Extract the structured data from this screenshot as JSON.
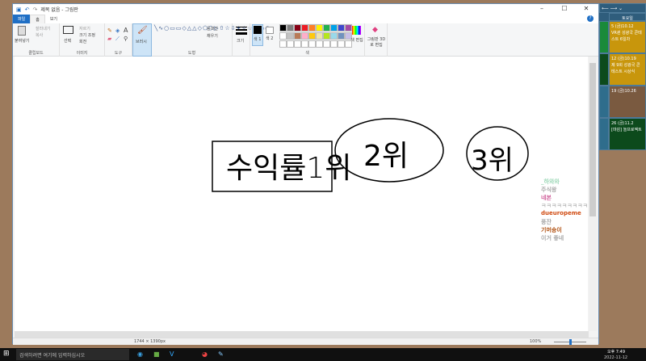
{
  "window": {
    "title": "제목 없음 - 그림판",
    "minimize": "–",
    "maximize": "☐",
    "close": "✕",
    "help": "?"
  },
  "tabs": [
    "파일",
    "홈",
    "보기"
  ],
  "ribbon": {
    "clipboard": {
      "paste": "붙여넣기",
      "cut": "잘라내기",
      "copy": "복사",
      "label": "클립보드"
    },
    "image": {
      "select": "선택",
      "crop": "자르기",
      "resize": "크기 조정",
      "rotate": "회전",
      "label": "이미지"
    },
    "tools": {
      "label": "도구"
    },
    "brushes": {
      "label": "브러시"
    },
    "shapes": {
      "outline": "윤곽선",
      "fill": "채우기",
      "label": "도형"
    },
    "size": {
      "label": "크기"
    },
    "colors": {
      "color1": "색 1",
      "color2": "색 2",
      "edit": "색 편집",
      "label": "색",
      "palette": [
        "#000000",
        "#7f7f7f",
        "#880015",
        "#ed1c24",
        "#ff7f27",
        "#fff200",
        "#22b14c",
        "#00a2e8",
        "#3f48cc",
        "#a349a4",
        "#ffffff",
        "#c3c3c3",
        "#b97a57",
        "#ffaec9",
        "#ffc90e",
        "#efe4b0",
        "#b5e61d",
        "#99d9ea",
        "#7092be",
        "#c8bfe7"
      ]
    },
    "paint3d": "그림판 3D로 편집"
  },
  "drawing": {
    "box_text": "수익률1위",
    "circle2_text": "2위",
    "circle3_text": "3위"
  },
  "overlay_notes": [
    {
      "text": "_하와와",
      "color": "#9ed8b8"
    },
    {
      "text": "주식왕",
      "color": "#aaaaaa"
    },
    {
      "text": "네본",
      "color": "#d0609a"
    },
    {
      "text": "ㅋㅋㅋㅋㅋㅋㅋㅋㅋㅋ",
      "color": "#bbbbbb"
    },
    {
      "text": "dueuropeme",
      "color": "#d04a10"
    },
    {
      "text": "풍잔",
      "color": "#aaaaaa"
    },
    {
      "text": "기머숑이",
      "color": "#b05010"
    },
    {
      "text": "이거 좋네",
      "color": "#aaaaaa"
    }
  ],
  "status": {
    "dimensions": "1744 × 1390px",
    "zoom": "100%",
    "zoom_level": 0.5
  },
  "taskbar": {
    "search_placeholder": "검색하려면 여기에 입력하십시오",
    "time": "오후 7:49",
    "date": "2022-11-12"
  },
  "calendar": {
    "header": "토요일",
    "events": [
      {
        "date": "5 (금)10.12",
        "text": "VR퀸 성광국 콘테스트 6일차",
        "color": "#c8960c"
      },
      {
        "date": "12 (금)10.19",
        "text": "제 9회 성광국 콘테스트 시상식",
        "color": "#c8960c"
      },
      {
        "date": "19 (금)10.26",
        "text": "",
        "color": "#7a5a40"
      },
      {
        "date": "26 (금)11.2",
        "text": "[마감] 놀프로젝트",
        "color": "#0c4a1c"
      }
    ]
  }
}
